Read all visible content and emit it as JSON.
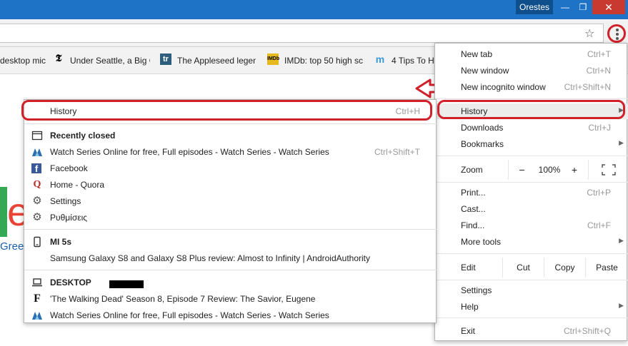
{
  "titlebar": {
    "user": "Orestes",
    "min": "—",
    "max": "❐",
    "close": "✕"
  },
  "bookmarks": [
    {
      "icon": "",
      "label": "desktop mic"
    },
    {
      "icon": "𝕿",
      "label": "Under Seattle, a Big C"
    },
    {
      "icon": "tr",
      "label": "The Appleseed legen"
    },
    {
      "icon": "IMDb",
      "label": "IMDb: top 50 high sc"
    },
    {
      "icon": "m",
      "label": "4 Tips To H"
    }
  ],
  "page": {
    "logo_letter": "e",
    "partial_link": "Gree"
  },
  "menu": {
    "new_tab": "New tab",
    "new_tab_sc": "Ctrl+T",
    "new_window": "New window",
    "new_window_sc": "Ctrl+N",
    "new_incognito": "New incognito window",
    "new_incognito_sc": "Ctrl+Shift+N",
    "history": "History",
    "downloads": "Downloads",
    "downloads_sc": "Ctrl+J",
    "bookmarks": "Bookmarks",
    "zoom": "Zoom",
    "zoom_minus": "−",
    "zoom_level": "100%",
    "zoom_plus": "+",
    "print": "Print...",
    "print_sc": "Ctrl+P",
    "cast": "Cast...",
    "find": "Find...",
    "find_sc": "Ctrl+F",
    "more_tools": "More tools",
    "edit": "Edit",
    "cut": "Cut",
    "copy": "Copy",
    "paste": "Paste",
    "settings": "Settings",
    "help": "Help",
    "exit": "Exit",
    "exit_sc": "Ctrl+Shift+Q"
  },
  "history": {
    "title": "History",
    "title_sc": "Ctrl+H",
    "recently_closed": "Recently closed",
    "recent": [
      {
        "icon": "series-icon",
        "label": "Watch Series Online for free, Full episodes - Watch Series - Watch Series",
        "sc": "Ctrl+Shift+T"
      },
      {
        "icon": "facebook-icon",
        "label": "Facebook",
        "sc": ""
      },
      {
        "icon": "quora-icon",
        "label": "Home - Quora",
        "sc": ""
      },
      {
        "icon": "gear-icon",
        "label": "Settings",
        "sc": ""
      },
      {
        "icon": "gear-icon",
        "label": "Ρυθμίσεις",
        "sc": ""
      }
    ],
    "device1": "MI 5s",
    "device1_item": "Samsung Galaxy S8 and Galaxy S8 Plus review: Almost to Infinity | AndroidAuthority",
    "device2": "DESKTOP",
    "device2_items": [
      "'The Walking Dead' Season 8, Episode 7 Review: The Savior, Eugene",
      "Watch Series Online for free, Full episodes - Watch Series - Watch Series"
    ]
  }
}
